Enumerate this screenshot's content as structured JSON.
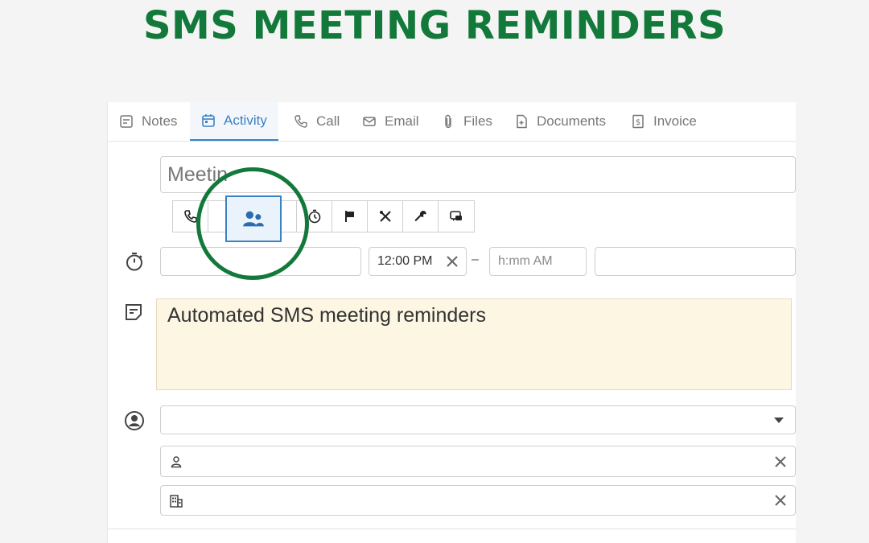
{
  "header": {
    "title": "SMS MEETING REMINDERS"
  },
  "tabs": [
    {
      "label": "Notes",
      "icon": "notes-icon"
    },
    {
      "label": "Activity",
      "icon": "calendar-icon",
      "active": true
    },
    {
      "label": "Call",
      "icon": "phone-icon"
    },
    {
      "label": "Email",
      "icon": "envelope-icon"
    },
    {
      "label": "Files",
      "icon": "paperclip-icon"
    },
    {
      "label": "Documents",
      "icon": "document-icon"
    },
    {
      "label": "Invoice",
      "icon": "invoice-icon"
    }
  ],
  "activity": {
    "title_value": "Meetin",
    "types": [
      "call",
      "meeting",
      "deadline",
      "flag",
      "lunch",
      "task",
      "chat"
    ],
    "selected_type": "meeting",
    "time": {
      "start_date": "",
      "start_time": "12:00 PM",
      "separator": "–",
      "end_time_placeholder": "h:mm AM",
      "end_date": ""
    },
    "description": "Automated SMS meeting reminders",
    "owner_value": "",
    "person_value": "",
    "organization_value": ""
  },
  "colors": {
    "brand_green": "#13793a",
    "accent_blue": "#3b82c4",
    "note_bg": "#fdf6e3"
  }
}
